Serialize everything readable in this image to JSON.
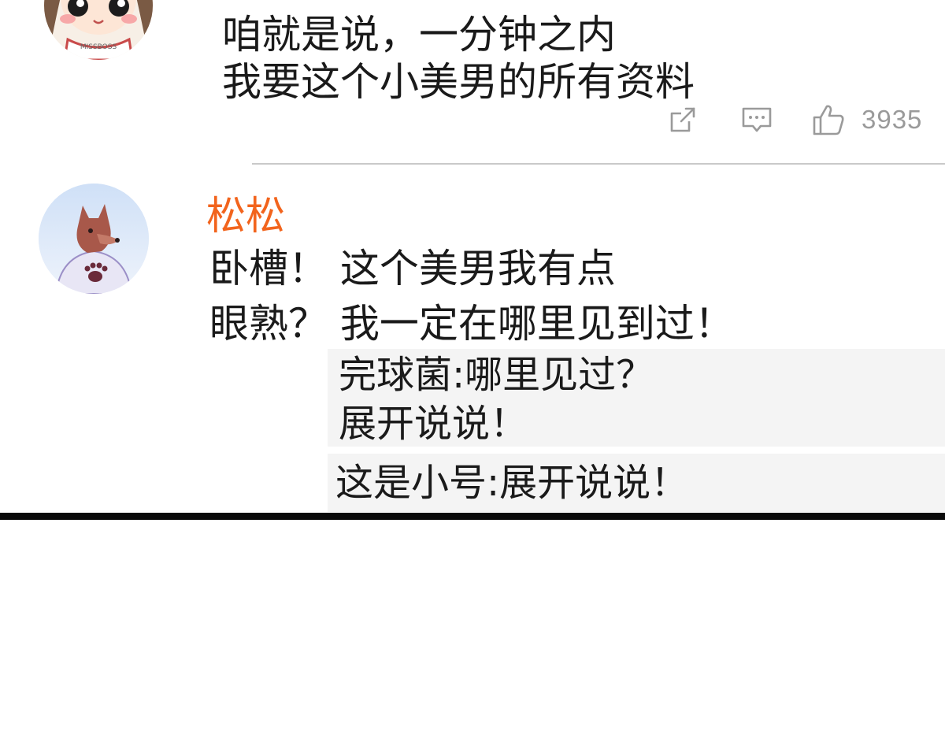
{
  "comments": [
    {
      "lines": [
        "咱就是说，一分钟之内",
        "我要这个小美男的所有资料"
      ],
      "actions": {
        "share_icon": "share-icon",
        "reply_icon": "comment-icon",
        "like_icon": "thumbs-up-icon",
        "like_count": "3935"
      }
    },
    {
      "username": "松松",
      "lines": [
        "卧槽！ 这个美男我有点",
        "眼熟？ 我一定在哪里见到过！"
      ],
      "replies": [
        {
          "lines": [
            "完球菌:哪里见过？",
            "展开说说！"
          ]
        },
        {
          "lines": [
            "这是小号:展开说说！"
          ]
        }
      ]
    }
  ],
  "colors": {
    "username": "#f2641d",
    "reply_background": "#f4f4f4",
    "icon_gray": "#9a9a9a",
    "divider": "#c9c9c9"
  }
}
